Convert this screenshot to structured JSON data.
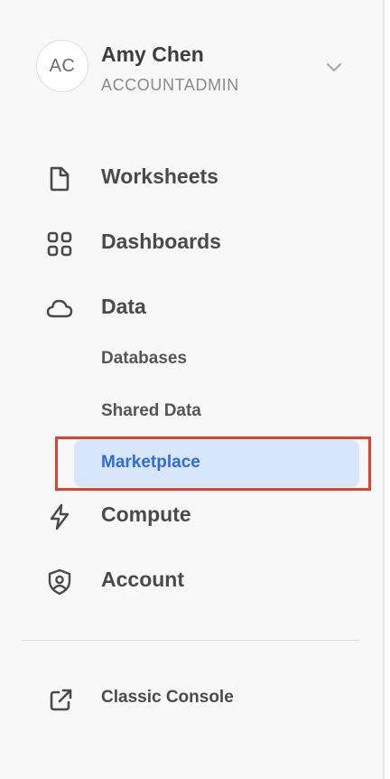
{
  "user": {
    "initials": "AC",
    "name": "Amy Chen",
    "role": "ACCOUNTADMIN"
  },
  "nav": {
    "worksheets": "Worksheets",
    "dashboards": "Dashboards",
    "data": "Data",
    "databases": "Databases",
    "shared_data": "Shared Data",
    "marketplace": "Marketplace",
    "compute": "Compute",
    "account": "Account",
    "classic_console": "Classic Console"
  },
  "icons": {
    "worksheets": "document-icon",
    "dashboards": "grid-icon",
    "data": "cloud-icon",
    "compute": "lightning-icon",
    "account": "shield-user-icon",
    "classic_console": "external-link-icon",
    "user_menu": "chevron-down-icon"
  },
  "colors": {
    "active_bg": "#d8e6fc",
    "active_text": "#2f6cd6",
    "highlight_border": "#e2412c"
  },
  "state": {
    "active_item": "marketplace"
  }
}
